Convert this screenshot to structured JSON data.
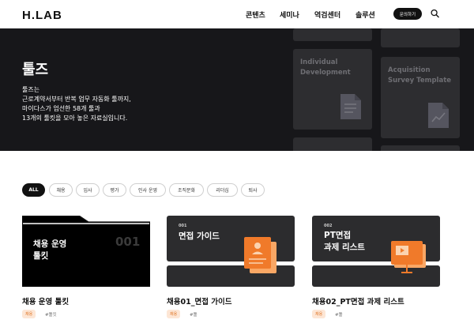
{
  "header": {
    "logo": "H.LAB",
    "nav": [
      "콘텐츠",
      "세미나",
      "역검센터",
      "솔루션"
    ],
    "inquiry_label": "문의하기"
  },
  "hero": {
    "title": "툴즈",
    "description_lines": [
      "툴즈는",
      "근로계약서부터 반복 업무 자동화 툴까지,",
      "마이다스가 엄선한 58개 툴과",
      "13개의 툴킷을 모아 놓은 자료실입니다."
    ],
    "cards": [
      "Individual Development",
      "Acquisition Survey Template"
    ]
  },
  "filters": [
    "ALL",
    "채용",
    "입사",
    "평가",
    "인사 운영",
    "조직문화",
    "리더십",
    "퇴사"
  ],
  "cards": [
    {
      "thumb_title_lines": [
        "채용 운영",
        "툴킷"
      ],
      "thumb_number": "001",
      "title": "채용 운영 툴킷",
      "badge": "채용",
      "hashtag": "#툴킷"
    },
    {
      "thumb_number": "001",
      "thumb_title": "면접 가이드",
      "title": "채용01_면접 가이드",
      "badge": "채용",
      "hashtag": "#툴"
    },
    {
      "thumb_number": "002",
      "thumb_title_lines": [
        "PT면접",
        "과제 리스트"
      ],
      "title": "채용02_PT면접 과제 리스트",
      "badge": "채용",
      "hashtag": "#툴"
    }
  ],
  "colors": {
    "hero_bg": "#17171a",
    "accent_orange": "#f07a2a",
    "tag_bg": "#fde6d5"
  },
  "icons": [
    "search-icon",
    "document-icon",
    "chart-icon",
    "person-card-icon",
    "presentation-icon"
  ]
}
